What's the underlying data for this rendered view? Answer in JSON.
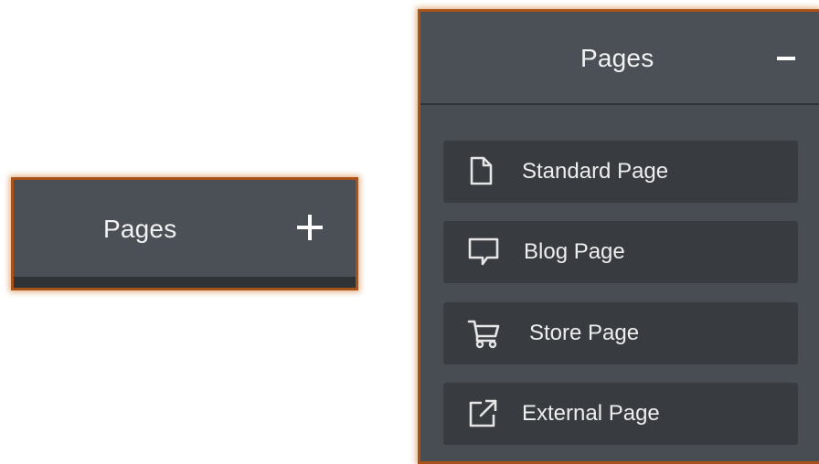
{
  "collapsed_panel": {
    "title": "Pages",
    "toggle_icon": "plus-icon"
  },
  "expanded_panel": {
    "title": "Pages",
    "toggle_icon": "minus-icon",
    "items": [
      {
        "label": "Standard Page",
        "icon": "document-icon"
      },
      {
        "label": "Blog Page",
        "icon": "speech-bubble-icon"
      },
      {
        "label": "Store Page",
        "icon": "shopping-cart-icon"
      },
      {
        "label": "External Page",
        "icon": "external-link-icon"
      }
    ]
  },
  "colors": {
    "panel_background": "#474d52",
    "item_background": "#383c40",
    "highlight_border": "#a8521a",
    "text": "#f2f2f2"
  }
}
